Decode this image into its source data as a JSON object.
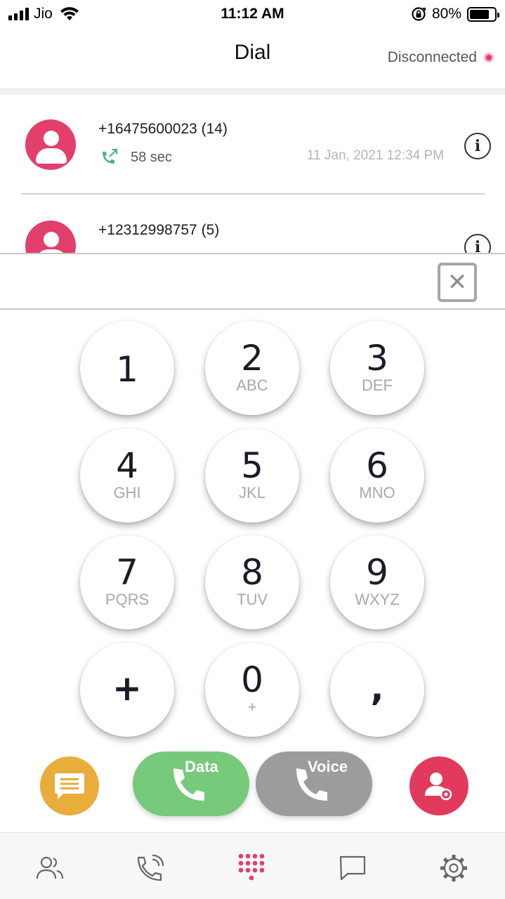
{
  "status_bar": {
    "carrier": "Jio",
    "time": "11:12 AM",
    "battery_percent": "80%",
    "battery_level": 0.8
  },
  "header": {
    "title": "Dial",
    "connection_status": "Disconnected",
    "status_color": "#e8386a"
  },
  "call_log": [
    {
      "number": "+16475600023 (14)",
      "duration": "58 sec",
      "date": "11 Jan, 2021 12:34 PM",
      "call_icon": "outgoing-call-icon"
    },
    {
      "number": "+12312998757 (5)",
      "duration": "",
      "date": "",
      "call_icon": "outgoing-call-icon"
    }
  ],
  "dial_input": {
    "value": ""
  },
  "keypad": {
    "keys": [
      {
        "digit": "1",
        "letters": ""
      },
      {
        "digit": "2",
        "letters": "ABC"
      },
      {
        "digit": "3",
        "letters": "DEF"
      },
      {
        "digit": "4",
        "letters": "GHI"
      },
      {
        "digit": "5",
        "letters": "JKL"
      },
      {
        "digit": "6",
        "letters": "MNO"
      },
      {
        "digit": "7",
        "letters": "PQRS"
      },
      {
        "digit": "8",
        "letters": "TUV"
      },
      {
        "digit": "9",
        "letters": "WXYZ"
      },
      {
        "digit": "+",
        "letters": ""
      },
      {
        "digit": "0",
        "letters": "+"
      },
      {
        "digit": ",",
        "letters": ""
      }
    ]
  },
  "actions": {
    "data_call_label": "Data",
    "voice_call_label": "Voice",
    "message_color": "#e9ad3b",
    "data_color": "#77c97b",
    "voice_color": "#9c9c9c",
    "add_contact_color": "#e23a5d"
  },
  "tabs": [
    {
      "icon": "contacts-icon"
    },
    {
      "icon": "recent-calls-icon"
    },
    {
      "icon": "dialpad-icon",
      "active": true
    },
    {
      "icon": "messages-icon"
    },
    {
      "icon": "settings-icon"
    }
  ],
  "colors": {
    "accent": "#e23f6d",
    "call_green": "#4cb87a"
  }
}
